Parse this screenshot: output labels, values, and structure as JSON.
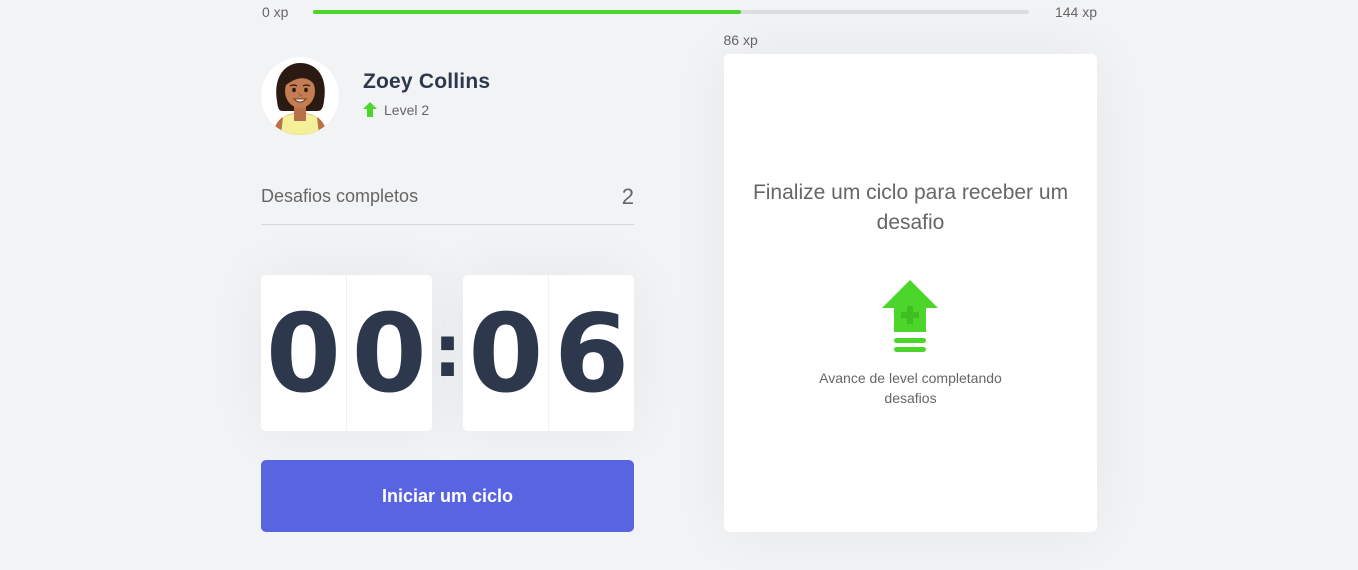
{
  "xp": {
    "min_label": "0 xp",
    "max_label": "144 xp",
    "current_label": "86 xp",
    "current": 86,
    "max": 144,
    "fill_color": "#4cd62b"
  },
  "profile": {
    "name": "Zoey Collins",
    "level_label": "Level 2",
    "avatar_icon": "avatar-woman",
    "level_icon": "level-up-arrow-icon"
  },
  "challenges": {
    "completed_label": "Desafios completos",
    "completed_value": "2"
  },
  "countdown": {
    "minute_left": "0",
    "minute_right": "0",
    "separator": ":",
    "second_left": "0",
    "second_right": "6"
  },
  "actions": {
    "start_label": "Iniciar um ciclo"
  },
  "challenge_box": {
    "title": "Finalize um ciclo para receber um desafio",
    "hint": "Avance de level completando desafios",
    "icon": "level-up-icon"
  },
  "colors": {
    "background": "#f2f3f5",
    "primary": "#5965e0",
    "green": "#4cd62b",
    "title": "#2e384d",
    "text": "#666666"
  }
}
